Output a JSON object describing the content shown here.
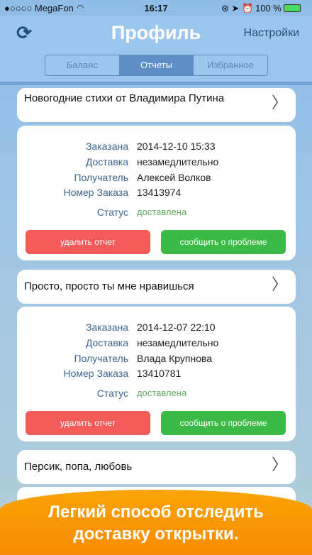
{
  "status_bar": {
    "carrier": "●○○○○ MegaFon",
    "wifi": "wifi-icon",
    "time": "16:17",
    "battery": "100 %"
  },
  "nav": {
    "title": "Профиль",
    "settings": "Настройки"
  },
  "tabs": [
    {
      "label": "Баланс"
    },
    {
      "label": "Отчеты",
      "active": true
    },
    {
      "label": "Избранное"
    }
  ],
  "labels": {
    "ordered": "Заказана",
    "delivery": "Доставка",
    "recipient": "Получатель",
    "order_no": "Номер Заказа",
    "status": "Статус",
    "delete": "удалить отчет",
    "report": "сообщить о проблеме"
  },
  "orders": [
    {
      "title": "Новогодние стихи от Владимира Путина",
      "ordered": "2014-12-10 15:33",
      "delivery": "незамедлительно",
      "recipient": "Алексей Волков",
      "order_no": "13413974",
      "status": "доставлена"
    },
    {
      "title": "Просто, просто ты мне нравишься",
      "ordered": "2014-12-07 22:10",
      "delivery": "незамедлительно",
      "recipient": "Влада Крупнова",
      "order_no": "13410781",
      "status": "доставлена"
    },
    {
      "title": "Персик, попа, любовь"
    }
  ],
  "banner": {
    "line1": "Легкий способ отследить",
    "line2": "доставку открытки."
  },
  "colors": {
    "delete": "#f35b5b",
    "report": "#3bbb45",
    "banner": "#f99a05"
  }
}
